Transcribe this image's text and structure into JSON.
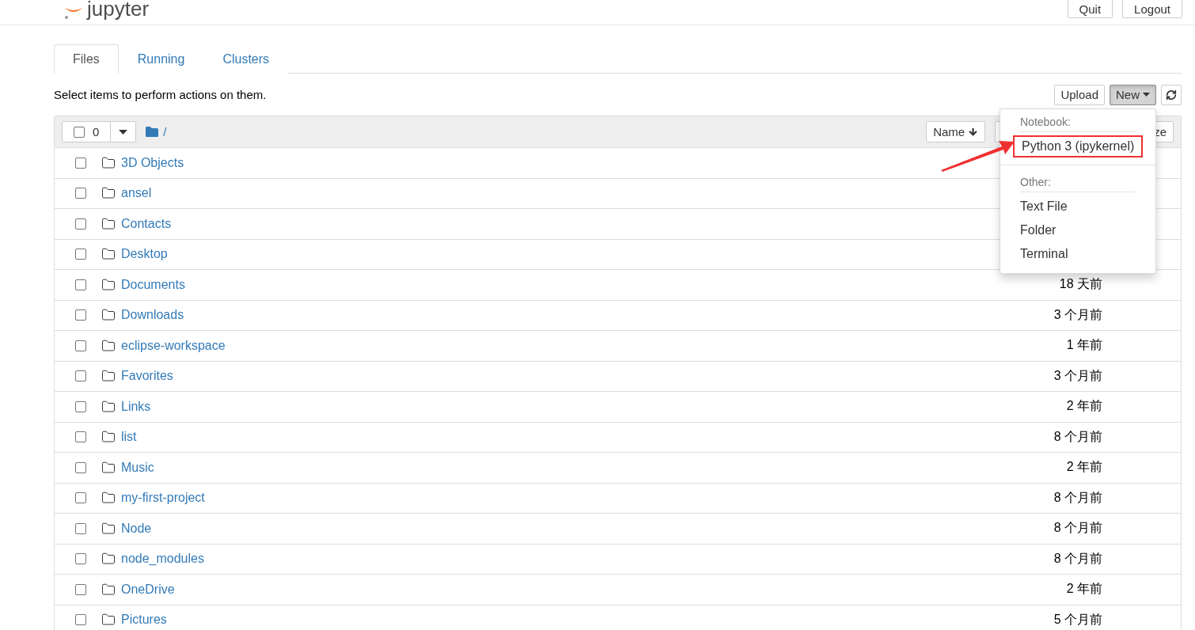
{
  "header": {
    "logo": "jupyter",
    "buttons": [
      "Quit",
      "Logout"
    ]
  },
  "tabs": [
    {
      "label": "Files",
      "selected": true
    },
    {
      "label": "Running",
      "selected": false
    },
    {
      "label": "Clusters",
      "selected": false
    }
  ],
  "hint": "Select items to perform actions on them.",
  "toolbar": {
    "upload": "Upload",
    "new": "New",
    "new_open": true
  },
  "list_header": {
    "select_count": "0",
    "all_checked": false,
    "path": "/",
    "sort_column": "Name",
    "column_fragment": "ze"
  },
  "new_menu": [
    {
      "kind": "header",
      "label": "Notebook:"
    },
    {
      "kind": "item",
      "label": "Python 3 (ipykernel)",
      "highlighted": true
    },
    {
      "kind": "divider"
    },
    {
      "kind": "header",
      "label": "Other:"
    },
    {
      "kind": "item",
      "label": "Text File",
      "highlighted": false
    },
    {
      "kind": "item",
      "label": "Folder",
      "highlighted": false
    },
    {
      "kind": "item",
      "label": "Terminal",
      "highlighted": false
    }
  ],
  "rows": [
    {
      "name": "3D Objects",
      "checked": false
    },
    {
      "name": "ansel",
      "checked": false
    },
    {
      "name": "Contacts",
      "checked": false
    },
    {
      "name": "Desktop",
      "checked": false
    },
    {
      "name": "Documents",
      "modified": "18 天前",
      "checked": false
    },
    {
      "name": "Downloads",
      "modified": "3 个月前",
      "checked": false
    },
    {
      "name": "eclipse-workspace",
      "modified": "1 年前",
      "checked": false
    },
    {
      "name": "Favorites",
      "modified": "3 个月前",
      "checked": false
    },
    {
      "name": "Links",
      "modified": "2 年前",
      "checked": false
    },
    {
      "name": "list",
      "modified": "8 个月前",
      "checked": false
    },
    {
      "name": "Music",
      "modified": "2 年前",
      "checked": false
    },
    {
      "name": "my-first-project",
      "modified": "8 个月前",
      "checked": false
    },
    {
      "name": "Node",
      "modified": "8 个月前",
      "checked": false
    },
    {
      "name": "node_modules",
      "modified": "8 个月前",
      "checked": false
    },
    {
      "name": "OneDrive",
      "modified": "2 年前",
      "checked": false
    },
    {
      "name": "Pictures",
      "modified": "5 个月前",
      "checked": false
    }
  ]
}
